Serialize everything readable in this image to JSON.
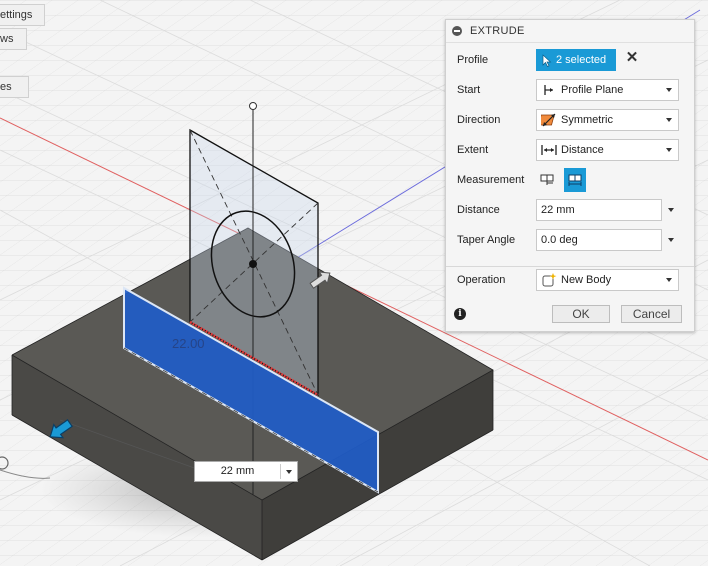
{
  "nav": {
    "items": [
      "ettings",
      "ws",
      "es"
    ]
  },
  "viewport": {
    "ghost_dimension": "22.00",
    "onscreen_distance": {
      "value": "22 mm"
    }
  },
  "panel": {
    "title": "EXTRUDE",
    "profile": {
      "label": "Profile",
      "value": "2 selected"
    },
    "start": {
      "label": "Start",
      "value": "Profile Plane"
    },
    "direction": {
      "label": "Direction",
      "value": "Symmetric"
    },
    "extent": {
      "label": "Extent",
      "value": "Distance"
    },
    "measurement": {
      "label": "Measurement",
      "options": [
        "half-length",
        "whole-length"
      ],
      "active": "whole-length"
    },
    "distance": {
      "label": "Distance",
      "value": "22 mm"
    },
    "taper_angle": {
      "label": "Taper Angle",
      "value": "0.0 deg"
    },
    "operation": {
      "label": "Operation",
      "value": "New Body"
    },
    "ok_label": "OK",
    "cancel_label": "Cancel"
  },
  "colors": {
    "accent": "#1a9ad6",
    "selection_fill": "#1f5cc8",
    "box_top": "#5c5b57",
    "box_side": "#4a4946"
  }
}
